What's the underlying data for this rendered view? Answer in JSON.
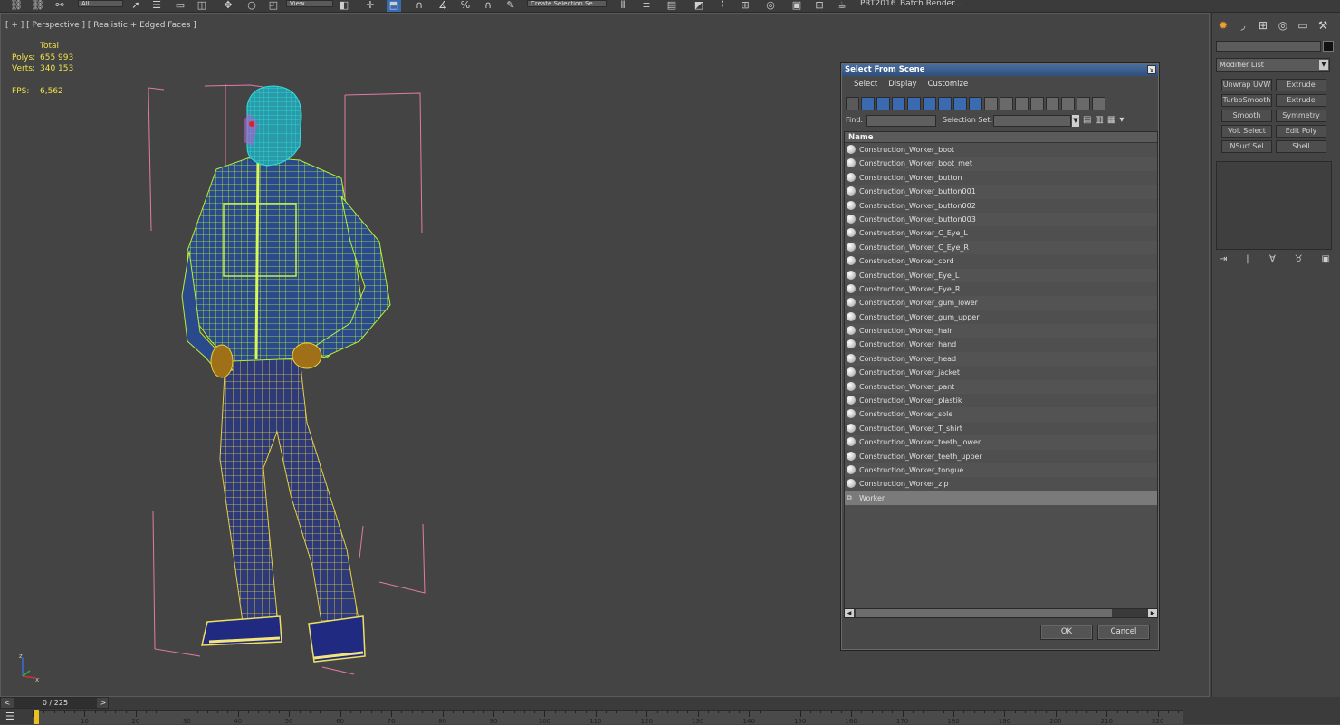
{
  "toolbar": {
    "filter_value": "All",
    "refcoord_value": "View",
    "selection_set_placeholder": "Create Selection Se",
    "text_items": [
      "PRT2016",
      "Batch Render..."
    ],
    "buttons": [
      "link-icon",
      "unlink-icon",
      "bind-icon",
      "filter-combo",
      "select-icon",
      "region-select-icon",
      "window-crossing-icon",
      "move-icon",
      "rotate-icon",
      "scale-icon",
      "refcoord-combo",
      "pivot-icon",
      "move-selected-icon",
      "snap-icon",
      "angle-snap-icon",
      "percent-snap-icon",
      "spinner-snap-icon",
      "edit-named-sets-icon",
      "mirror-icon",
      "align-icon",
      "layer-icon",
      "graphite-icon",
      "curve-editor-icon",
      "schematic-icon",
      "material-editor-icon",
      "render-setup-icon",
      "render-frame-icon",
      "render-icon"
    ]
  },
  "viewport": {
    "label": "[ + ] [ Perspective ] [ Realistic + Edged Faces ]",
    "stats": {
      "total_label": "Total",
      "polys_label": "Polys:",
      "polys_value": "655 993",
      "verts_label": "Verts:",
      "verts_value": "340 153",
      "fps_label": "FPS:",
      "fps_value": "6,562"
    },
    "axis": {
      "z": "z",
      "x": "x"
    }
  },
  "dialog": {
    "title": "Select From Scene",
    "close_label": "x",
    "menu": [
      "Select",
      "Display",
      "Customize"
    ],
    "find_label": "Find:",
    "find_value": "",
    "selection_set_label": "Selection Set:",
    "selection_set_value": "",
    "column_header": "Name",
    "items": [
      {
        "name": "Construction_Worker_boot",
        "icon": "sphere-icon",
        "selected": false
      },
      {
        "name": "Construction_Worker_boot_met",
        "icon": "sphere-icon",
        "selected": false
      },
      {
        "name": "Construction_Worker_button",
        "icon": "sphere-icon",
        "selected": false
      },
      {
        "name": "Construction_Worker_button001",
        "icon": "sphere-icon",
        "selected": false
      },
      {
        "name": "Construction_Worker_button002",
        "icon": "sphere-icon",
        "selected": false
      },
      {
        "name": "Construction_Worker_button003",
        "icon": "sphere-icon",
        "selected": false
      },
      {
        "name": "Construction_Worker_C_Eye_L",
        "icon": "sphere-icon",
        "selected": false
      },
      {
        "name": "Construction_Worker_C_Eye_R",
        "icon": "sphere-icon",
        "selected": false
      },
      {
        "name": "Construction_Worker_cord",
        "icon": "sphere-icon",
        "selected": false
      },
      {
        "name": "Construction_Worker_Eye_L",
        "icon": "sphere-icon",
        "selected": false
      },
      {
        "name": "Construction_Worker_Eye_R",
        "icon": "sphere-icon",
        "selected": false
      },
      {
        "name": "Construction_Worker_gum_lower",
        "icon": "sphere-icon",
        "selected": false
      },
      {
        "name": "Construction_Worker_gum_upper",
        "icon": "sphere-icon",
        "selected": false
      },
      {
        "name": "Construction_Worker_hair",
        "icon": "sphere-icon",
        "selected": false
      },
      {
        "name": "Construction_Worker_hand",
        "icon": "sphere-icon",
        "selected": false
      },
      {
        "name": "Construction_Worker_head",
        "icon": "sphere-icon",
        "selected": false
      },
      {
        "name": "Construction_Worker_jacket",
        "icon": "sphere-icon",
        "selected": false
      },
      {
        "name": "Construction_Worker_pant",
        "icon": "sphere-icon",
        "selected": false
      },
      {
        "name": "Construction_Worker_plastik",
        "icon": "sphere-icon",
        "selected": false
      },
      {
        "name": "Construction_Worker_sole",
        "icon": "sphere-icon",
        "selected": false
      },
      {
        "name": "Construction_Worker_T_shirt",
        "icon": "sphere-icon",
        "selected": false
      },
      {
        "name": "Construction_Worker_teeth_lower",
        "icon": "sphere-icon",
        "selected": false
      },
      {
        "name": "Construction_Worker_teeth_upper",
        "icon": "sphere-icon",
        "selected": false
      },
      {
        "name": "Construction_Worker_tongue",
        "icon": "sphere-icon",
        "selected": false
      },
      {
        "name": "Construction_Worker_zip",
        "icon": "sphere-icon",
        "selected": false
      },
      {
        "name": "Worker",
        "icon": "group-icon",
        "selected": true
      }
    ],
    "ok_label": "OK",
    "cancel_label": "Cancel"
  },
  "command_panel": {
    "tabs": [
      "create-icon",
      "modify-icon",
      "hierarchy-icon",
      "motion-icon",
      "display-icon",
      "utilities-icon"
    ],
    "name_value": "",
    "modifier_list_label": "Modifier List",
    "modifier_buttons": [
      "Unwrap UVW",
      "Extrude",
      "TurboSmooth",
      "Extrude",
      "Smooth",
      "Symmetry",
      "Vol. Select",
      "Edit Poly",
      "NSurf Sel",
      "Shell"
    ],
    "stack_icons": [
      "pin-stack-icon",
      "show-end-result-icon",
      "make-unique-icon",
      "remove-modifier-icon",
      "configure-sets-icon"
    ]
  },
  "timeline": {
    "frame_display": "0 / 225",
    "prev_label": "<",
    "next_label": ">",
    "ticks": [
      10,
      20,
      30,
      40,
      50,
      60,
      70,
      80,
      90,
      100,
      110,
      120,
      130,
      140,
      150,
      160,
      170,
      180,
      190,
      200,
      210,
      220
    ]
  },
  "colors": {
    "viewport_bg": "#444444",
    "stats_yellow": "#f0e24a",
    "bbox_pink": "#e27aa8",
    "wire_yellow": "#e8d040",
    "wire_cyan": "#30e0e0",
    "wire_green": "#b8f030",
    "dialog_title_blue": "#3a5c8c"
  }
}
